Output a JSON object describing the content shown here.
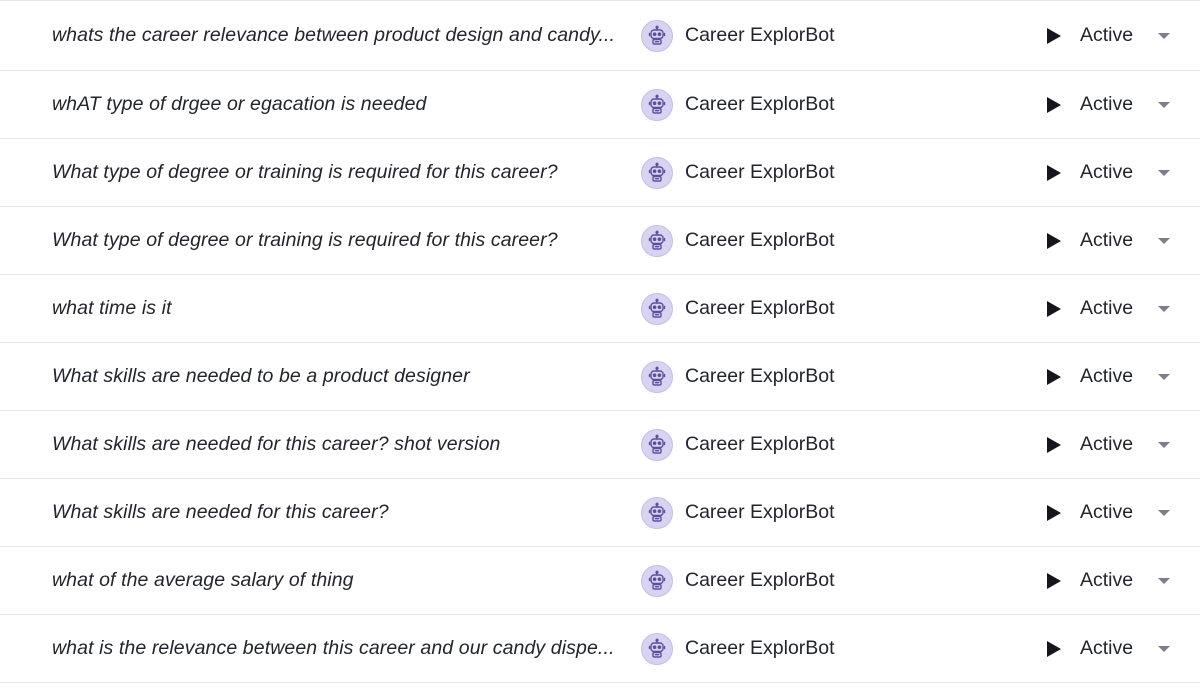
{
  "rows": [
    {
      "prompt": "whats the career relevance between product design and candy...",
      "bot_name": "Career ExplorBot",
      "bot_icon": "robot-avatar-icon",
      "status": "Active"
    },
    {
      "prompt": "whAT type of drgee or egacation is needed",
      "bot_name": "Career ExplorBot",
      "bot_icon": "robot-avatar-icon",
      "status": "Active"
    },
    {
      "prompt": "What type of degree or training is required for this career?",
      "bot_name": "Career ExplorBot",
      "bot_icon": "robot-avatar-icon",
      "status": "Active"
    },
    {
      "prompt": "What type of degree or training is required for this career?",
      "bot_name": "Career ExplorBot",
      "bot_icon": "robot-avatar-icon",
      "status": "Active"
    },
    {
      "prompt": "what time is it",
      "bot_name": "Career ExplorBot",
      "bot_icon": "robot-avatar-icon",
      "status": "Active"
    },
    {
      "prompt": "What skills are needed to be a product designer",
      "bot_name": "Career ExplorBot",
      "bot_icon": "robot-avatar-icon",
      "status": "Active"
    },
    {
      "prompt": "What skills are needed for this career? shot version",
      "bot_name": "Career ExplorBot",
      "bot_icon": "robot-avatar-icon",
      "status": "Active"
    },
    {
      "prompt": "What skills are needed for this career?",
      "bot_name": "Career ExplorBot",
      "bot_icon": "robot-avatar-icon",
      "status": "Active"
    },
    {
      "prompt": "what of the average salary of thing",
      "bot_name": "Career ExplorBot",
      "bot_icon": "robot-avatar-icon",
      "status": "Active"
    },
    {
      "prompt": "what is the relevance between this career and our candy dispe...",
      "bot_name": "Career ExplorBot",
      "bot_icon": "robot-avatar-icon",
      "status": "Active"
    }
  ],
  "icons": {
    "play": "play-icon",
    "expand": "chevron-down-icon"
  },
  "colors": {
    "text": "#22252c",
    "divider": "#e4e5e9",
    "avatar_bg": "#d9d3f2",
    "avatar_stroke": "#5b4fa0",
    "chevron": "#7b7f88"
  }
}
